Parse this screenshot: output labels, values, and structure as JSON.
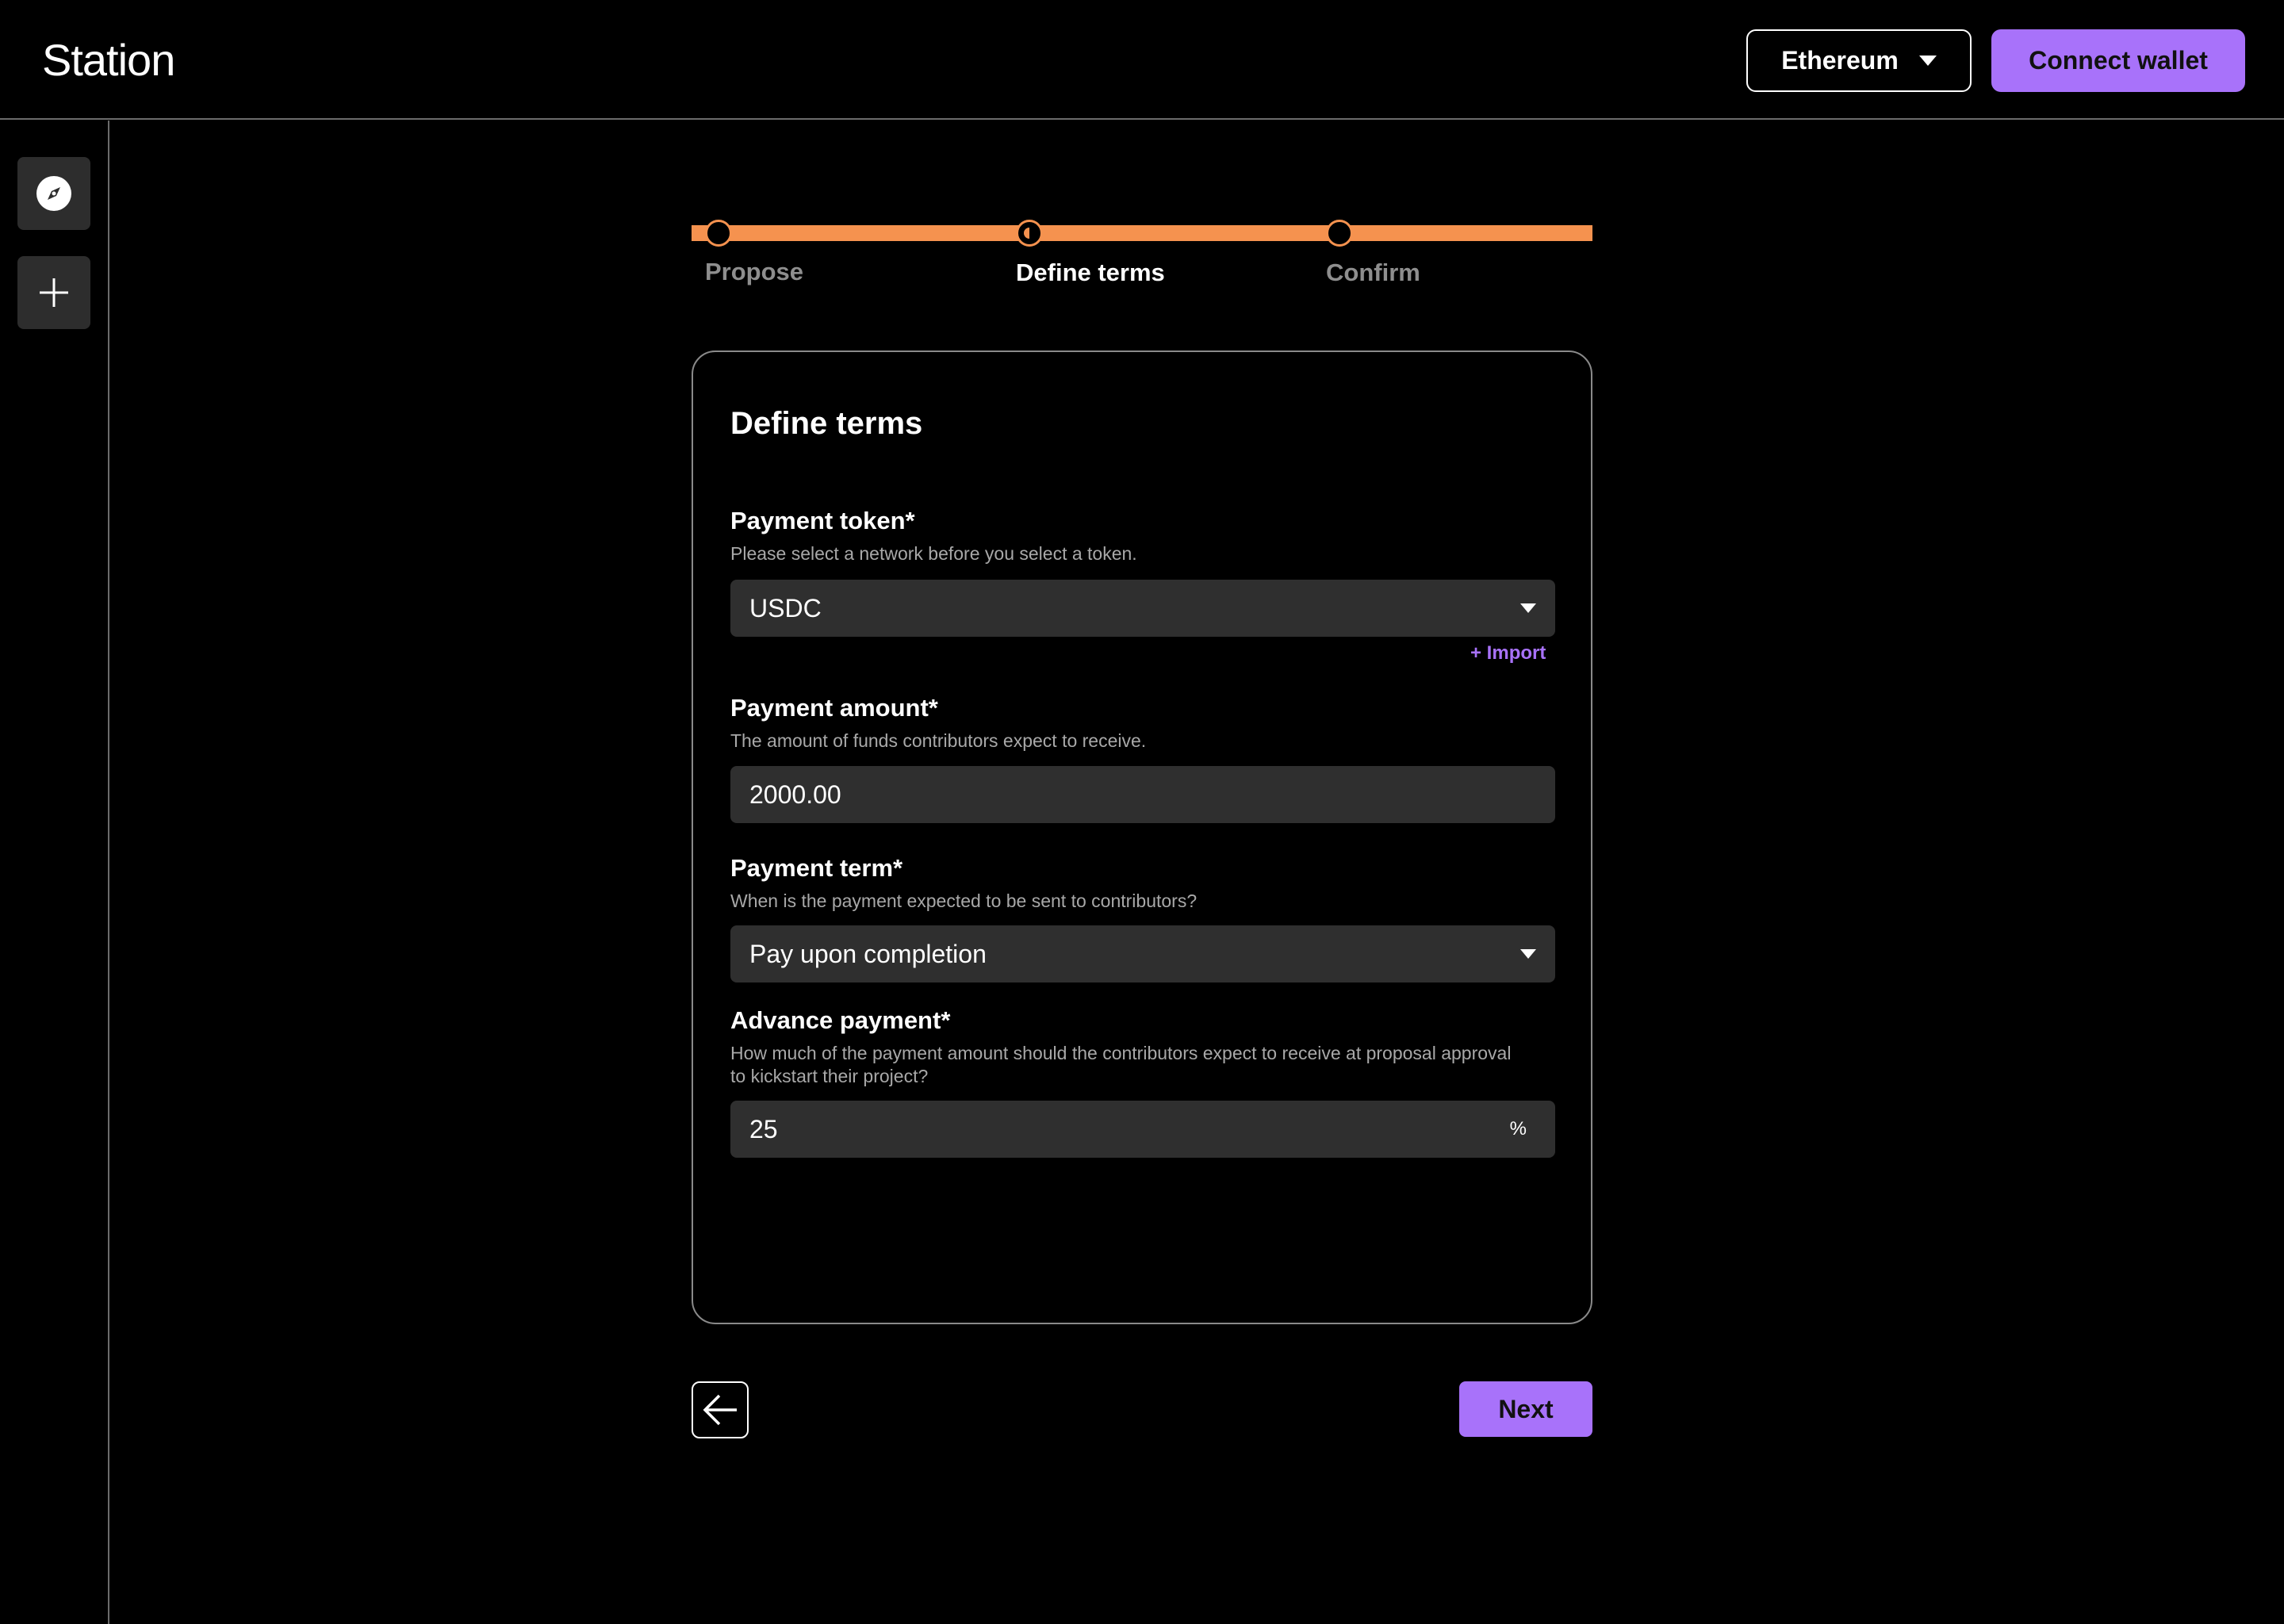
{
  "header": {
    "app_title": "Station",
    "network_label": "Ethereum",
    "connect_label": "Connect wallet"
  },
  "sidebar": {
    "items": [
      {
        "icon": "compass-icon"
      },
      {
        "icon": "plus-icon"
      }
    ]
  },
  "stepper": {
    "steps": [
      "Propose",
      "Define terms",
      "Confirm"
    ],
    "active_index": 1
  },
  "form": {
    "title": "Define terms",
    "payment_token": {
      "label": "Payment token*",
      "help": "Please select a network before you select a token.",
      "value": "USDC",
      "import_label": "+ Import"
    },
    "payment_amount": {
      "label": "Payment amount*",
      "help": "The amount of funds contributors expect to receive.",
      "value": "2000.00"
    },
    "payment_term": {
      "label": "Payment term*",
      "help": "When is the payment expected to be sent to contributors?",
      "value": "Pay upon completion"
    },
    "advance_payment": {
      "label": "Advance payment*",
      "help": "How much of the payment amount should the contributors expect to receive at proposal approval to kickstart their project?",
      "value": "25",
      "suffix": "%"
    }
  },
  "footer": {
    "next_label": "Next"
  },
  "colors": {
    "accent": "#a872fa",
    "stepper": "#f5924f",
    "field_bg": "#2f2f2f"
  }
}
